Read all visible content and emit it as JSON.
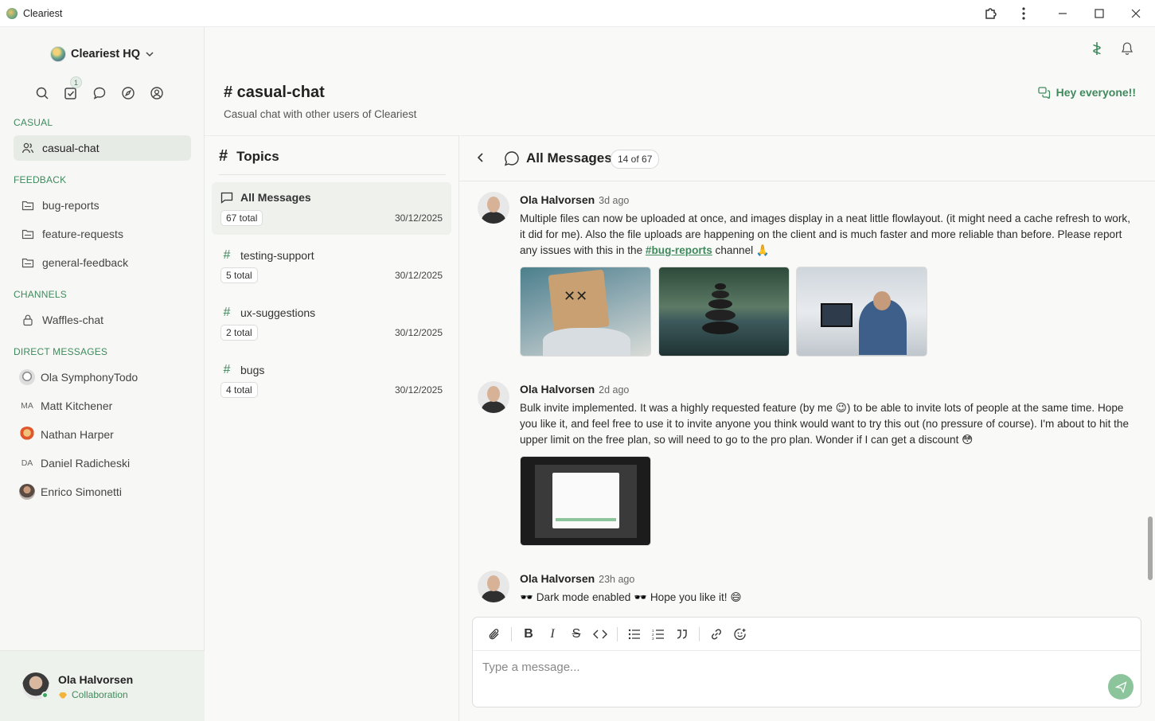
{
  "window": {
    "title": "Cleariest"
  },
  "workspace": {
    "name": "Cleariest HQ"
  },
  "nav_icons": {
    "tasks_badge": "1"
  },
  "sidebar": {
    "sections": {
      "casual": "CASUAL",
      "feedback": "FEEDBACK",
      "channels": "CHANNELS",
      "dms": "DIRECT MESSAGES"
    },
    "casual_items": [
      {
        "label": "casual-chat",
        "icon": "users-icon",
        "active": true
      }
    ],
    "feedback_items": [
      {
        "label": "bug-reports",
        "icon": "folder-icon"
      },
      {
        "label": "feature-requests",
        "icon": "folder-icon"
      },
      {
        "label": "general-feedback",
        "icon": "folder-icon"
      }
    ],
    "channel_items": [
      {
        "label": "Waffles-chat",
        "icon": "lock-icon"
      }
    ],
    "dms": [
      {
        "name": "Ola SymphonyTodo",
        "initials": ""
      },
      {
        "name": "Matt Kitchener",
        "initials": "MA"
      },
      {
        "name": "Nathan Harper",
        "initials": ""
      },
      {
        "name": "Daniel Radicheski",
        "initials": "DA"
      },
      {
        "name": "Enrico Simonetti",
        "initials": ""
      }
    ]
  },
  "user": {
    "name": "Ola Halvorsen",
    "status": "Collaboration"
  },
  "channel": {
    "title": "# casual-chat",
    "description": "Casual chat with other users of Cleariest",
    "pinned": "Hey everyone!!"
  },
  "topics": {
    "heading": "Topics",
    "items": [
      {
        "name": "All Messages",
        "count": "67 total",
        "date": "30/12/2025",
        "active": true
      },
      {
        "name": "testing-support",
        "count": "5 total",
        "date": "30/12/2025"
      },
      {
        "name": "ux-suggestions",
        "count": "2 total",
        "date": "30/12/2025"
      },
      {
        "name": "bugs",
        "count": "4 total",
        "date": "30/12/2025"
      }
    ]
  },
  "messages_view": {
    "title": "All Messages",
    "count": "14 of 67",
    "messages": [
      {
        "author": "Ola Halvorsen",
        "time": "3d ago",
        "text_a": "Multiple files can now be uploaded at once, and images display in a neat little flowlayout. (it might need a cache refresh to work, it did for me). Also the file uploads are happening on the client and is much faster and more reliable than before. Please report any issues with this in the ",
        "link": "#bug-reports",
        "text_b": " channel 🙏"
      },
      {
        "author": "Ola Halvorsen",
        "time": "2d ago",
        "text": "Bulk invite implemented. It was a highly requested feature (by me 😉) to be able to invite lots of people at the same time. Hope you like it, and feel free to use it to invite anyone you think would want to try this out (no pressure of course). I'm about to hit the upper limit on the free plan, so will need to go to the pro plan. Wonder if I can get a discount 😳"
      },
      {
        "author": "Ola Halvorsen",
        "time": "23h ago",
        "text": "🕶️ Dark mode enabled 🕶️ Hope you like it! 😄"
      }
    ]
  },
  "composer": {
    "placeholder": "Type a message..."
  },
  "colors": {
    "accent": "#3f8a5d",
    "sidebar_bg": "#f7f8f6",
    "send_button": "#8cc49c"
  }
}
